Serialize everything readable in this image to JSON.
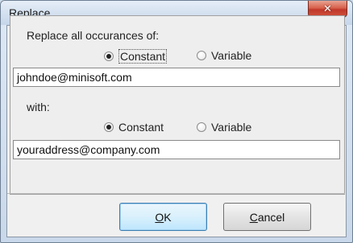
{
  "window": {
    "title": "Replace",
    "close_icon": "✕"
  },
  "find": {
    "label": "Replace all occurances of:",
    "radio_constant": "Constant",
    "radio_variable": "Variable",
    "selected": "Constant",
    "value": "johndoe@minisoft.com"
  },
  "replace": {
    "label": "with:",
    "radio_constant": "Constant",
    "radio_variable": "Variable",
    "selected": "Constant",
    "value": "youraddress@company.com"
  },
  "buttons": {
    "ok_mnemonic": "O",
    "ok_rest": "K",
    "cancel_mnemonic": "C",
    "cancel_rest": "ancel"
  }
}
